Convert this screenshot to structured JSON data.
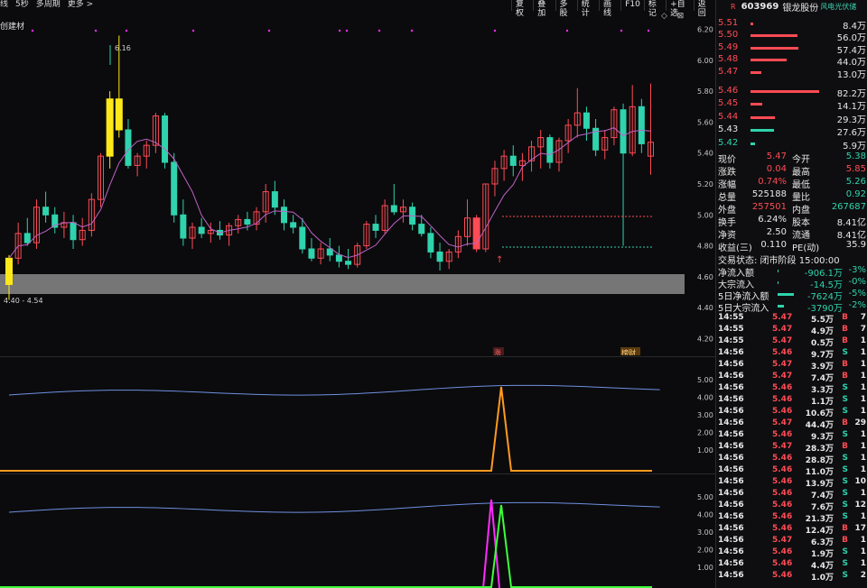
{
  "toolbar_left": [
    "线",
    "5秒",
    "多周期",
    "更多 >"
  ],
  "toolbar_right": [
    "复权",
    "叠加",
    "多股",
    "统计",
    "画线",
    "F10",
    "标记",
    "+自选",
    "返回"
  ],
  "chart_title": "创建材",
  "window_icons": "◇ ⊠",
  "price_high_label": "6.16",
  "price_axis": [
    "6.20",
    "6.00",
    "5.80",
    "5.60",
    "5.40",
    "5.20",
    "5.00",
    "4.80",
    "4.60",
    "4.40",
    "4.20"
  ],
  "band_label": "4.40 - 4.54",
  "sub_axis_1": [
    "5.00",
    "4.00",
    "3.00",
    "2.00",
    "1.00"
  ],
  "sub_axis_2": [
    "5.00",
    "4.00",
    "3.00",
    "2.00",
    "1.00"
  ],
  "marker_zhang": "涨",
  "marker_bangcai": "榜财",
  "colors": {
    "up": "#ff4b55",
    "down": "#2fd3ad",
    "yellow": "#ffe81a",
    "ma": "#c061c8",
    "line": "#6f8fe0",
    "orange": "#ff9a1f",
    "magenta": "#ff2bff",
    "lime": "#3cff3c"
  },
  "stock": {
    "badge": "R",
    "code": "603969",
    "name": "银龙股份",
    "concept": "风电光伏储"
  },
  "asks": [
    {
      "price": "5.51",
      "vol": "8.4万",
      "bar": 0.04
    },
    {
      "price": "5.50",
      "vol": "56.0万",
      "bar": 0.6
    },
    {
      "price": "5.49",
      "vol": "57.4万",
      "bar": 0.62
    },
    {
      "price": "5.48",
      "vol": "44.0万",
      "bar": 0.47
    },
    {
      "price": "5.47",
      "vol": "13.0万",
      "bar": 0.14
    }
  ],
  "bids": [
    {
      "price": "5.46",
      "vol": "82.2万",
      "bar": 0.88,
      "cls": "red"
    },
    {
      "price": "5.45",
      "vol": "14.1万",
      "bar": 0.15,
      "cls": "red"
    },
    {
      "price": "5.44",
      "vol": "29.3万",
      "bar": 0.31,
      "cls": "red"
    },
    {
      "price": "5.43",
      "vol": "27.6万",
      "bar": 0.3,
      "cls": "white"
    },
    {
      "price": "5.42",
      "vol": "5.9万",
      "bar": 0.06,
      "cls": "green"
    }
  ],
  "quote": [
    {
      "l1": "现价",
      "v1": "5.47",
      "c1": "red",
      "l2": "今开",
      "v2": "5.38",
      "c2": "green"
    },
    {
      "l1": "涨跌",
      "v1": "0.04",
      "c1": "red",
      "l2": "最高",
      "v2": "5.85",
      "c2": "red"
    },
    {
      "l1": "涨幅",
      "v1": "0.74%",
      "c1": "red",
      "l2": "最低",
      "v2": "5.26",
      "c2": "green"
    },
    {
      "l1": "总量",
      "v1": "525188",
      "c1": "white",
      "l2": "量比",
      "v2": "0.92",
      "c2": "green"
    },
    {
      "l1": "外盘",
      "v1": "257501",
      "c1": "red",
      "l2": "内盘",
      "v2": "267687",
      "c2": "green"
    },
    {
      "l1": "换手",
      "v1": "6.24%",
      "c1": "white",
      "l2": "股本",
      "v2": "8.41亿",
      "c2": "white"
    },
    {
      "l1": "净资",
      "v1": "2.50",
      "c1": "white",
      "l2": "流通",
      "v2": "8.41亿",
      "c2": "white"
    },
    {
      "l1": "收益(三)",
      "v1": "0.110",
      "c1": "white",
      "l2": "PE(动)",
      "v2": "35.9",
      "c2": "white"
    }
  ],
  "trade_status": "交易状态: 闭市阶段 15:00:00",
  "flows": [
    {
      "label": "净流入额",
      "value": "-906.1万",
      "pct": "-3%",
      "bar": 0.02
    },
    {
      "label": "大宗流入",
      "value": "-14.5万",
      "pct": "-0%",
      "bar": 0.01
    },
    {
      "label": "5日净流入额",
      "value": "-7624万",
      "pct": "-5%",
      "bar": 0.9
    },
    {
      "label": "5日大宗流入",
      "value": "-3790万",
      "pct": "-2%",
      "bar": 0.35
    }
  ],
  "ticks": [
    {
      "t": "14:55",
      "p": "5.47",
      "v": "5.5万",
      "s": "B",
      "n": "7"
    },
    {
      "t": "14:55",
      "p": "5.47",
      "v": "4.9万",
      "s": "B",
      "n": "7"
    },
    {
      "t": "14:55",
      "p": "5.47",
      "v": "0.5万",
      "s": "B",
      "n": "1"
    },
    {
      "t": "14:56",
      "p": "5.46",
      "v": "9.7万",
      "s": "S",
      "n": "1"
    },
    {
      "t": "14:56",
      "p": "5.47",
      "v": "3.9万",
      "s": "B",
      "n": "1"
    },
    {
      "t": "14:56",
      "p": "5.47",
      "v": "7.4万",
      "s": "B",
      "n": "1"
    },
    {
      "t": "14:56",
      "p": "5.46",
      "v": "3.3万",
      "s": "S",
      "n": "1"
    },
    {
      "t": "14:56",
      "p": "5.46",
      "v": "1.1万",
      "s": "S",
      "n": "1"
    },
    {
      "t": "14:56",
      "p": "5.46",
      "v": "10.6万",
      "s": "S",
      "n": "1"
    },
    {
      "t": "14:56",
      "p": "5.47",
      "v": "44.4万",
      "s": "B",
      "n": "29"
    },
    {
      "t": "14:56",
      "p": "5.46",
      "v": "9.3万",
      "s": "S",
      "n": "1"
    },
    {
      "t": "14:56",
      "p": "5.47",
      "v": "28.3万",
      "s": "B",
      "n": "1"
    },
    {
      "t": "14:56",
      "p": "5.46",
      "v": "28.8万",
      "s": "S",
      "n": "1"
    },
    {
      "t": "14:56",
      "p": "5.46",
      "v": "11.0万",
      "s": "S",
      "n": "1"
    },
    {
      "t": "14:56",
      "p": "5.46",
      "v": "13.9万",
      "s": "S",
      "n": "10"
    },
    {
      "t": "14:56",
      "p": "5.46",
      "v": "7.4万",
      "s": "S",
      "n": "1"
    },
    {
      "t": "14:56",
      "p": "5.46",
      "v": "7.6万",
      "s": "S",
      "n": "12"
    },
    {
      "t": "14:56",
      "p": "5.46",
      "v": "21.3万",
      "s": "S",
      "n": "1"
    },
    {
      "t": "14:56",
      "p": "5.46",
      "v": "12.4万",
      "s": "B",
      "n": "17"
    },
    {
      "t": "14:56",
      "p": "5.47",
      "v": "6.3万",
      "s": "B",
      "n": "1"
    },
    {
      "t": "14:56",
      "p": "5.46",
      "v": "1.9万",
      "s": "S",
      "n": "1"
    },
    {
      "t": "14:56",
      "p": "5.46",
      "v": "4.4万",
      "s": "S",
      "n": "1"
    },
    {
      "t": "14:56",
      "p": "5.46",
      "v": "1.0万",
      "s": "S",
      "n": "2"
    }
  ],
  "chart_data": {
    "type": "candlestick",
    "candles": [
      [
        4.55,
        4.74,
        4.45,
        4.72
      ],
      [
        4.72,
        4.95,
        4.68,
        4.88
      ],
      [
        4.88,
        4.98,
        4.8,
        4.82
      ],
      [
        4.82,
        5.1,
        4.78,
        5.05
      ],
      [
        5.05,
        5.15,
        4.95,
        5.0
      ],
      [
        5.0,
        5.05,
        4.88,
        4.92
      ],
      [
        4.92,
        5.02,
        4.85,
        4.95
      ],
      [
        4.95,
        5.0,
        4.78,
        4.84
      ],
      [
        4.84,
        4.98,
        4.8,
        4.9
      ],
      [
        4.9,
        5.14,
        4.86,
        5.1
      ],
      [
        5.1,
        5.4,
        5.05,
        5.38
      ],
      [
        5.38,
        5.8,
        5.3,
        5.75
      ],
      [
        5.75,
        6.16,
        5.5,
        5.55
      ],
      [
        5.55,
        5.62,
        5.3,
        5.32
      ],
      [
        5.32,
        5.4,
        5.25,
        5.38
      ],
      [
        5.38,
        5.48,
        5.3,
        5.45
      ],
      [
        5.45,
        5.66,
        5.4,
        5.64
      ],
      [
        5.64,
        5.66,
        5.3,
        5.34
      ],
      [
        5.34,
        5.4,
        4.95,
        5.0
      ],
      [
        5.0,
        5.1,
        4.8,
        4.85
      ],
      [
        4.85,
        4.95,
        4.78,
        4.92
      ],
      [
        4.92,
        4.98,
        4.85,
        4.88
      ],
      [
        4.88,
        4.95,
        4.82,
        4.9
      ],
      [
        4.9,
        4.96,
        4.84,
        4.87
      ],
      [
        4.87,
        4.95,
        4.8,
        4.93
      ],
      [
        4.93,
        5.0,
        4.88,
        4.97
      ],
      [
        4.97,
        5.02,
        4.9,
        4.94
      ],
      [
        4.94,
        5.05,
        4.9,
        5.02
      ],
      [
        5.02,
        5.2,
        4.95,
        5.15
      ],
      [
        5.15,
        5.22,
        5.0,
        5.05
      ],
      [
        5.05,
        5.1,
        4.9,
        4.95
      ],
      [
        4.95,
        5.0,
        4.88,
        4.92
      ],
      [
        4.92,
        4.98,
        4.75,
        4.78
      ],
      [
        4.78,
        4.85,
        4.7,
        4.72
      ],
      [
        4.72,
        4.82,
        4.68,
        4.78
      ],
      [
        4.78,
        4.85,
        4.7,
        4.74
      ],
      [
        4.74,
        4.8,
        4.66,
        4.7
      ],
      [
        4.7,
        4.78,
        4.65,
        4.68
      ],
      [
        4.68,
        4.82,
        4.66,
        4.8
      ],
      [
        4.8,
        4.96,
        4.78,
        4.94
      ],
      [
        4.94,
        5.0,
        4.85,
        4.9
      ],
      [
        4.9,
        5.1,
        4.88,
        5.06
      ],
      [
        5.06,
        5.2,
        5.0,
        5.02
      ],
      [
        5.02,
        5.1,
        4.95,
        5.05
      ],
      [
        5.05,
        5.08,
        4.9,
        4.94
      ],
      [
        4.94,
        5.0,
        4.86,
        4.88
      ],
      [
        4.88,
        4.92,
        4.72,
        4.76
      ],
      [
        4.76,
        4.82,
        4.64,
        4.7
      ],
      [
        4.7,
        4.78,
        4.65,
        4.76
      ],
      [
        4.76,
        4.9,
        4.72,
        4.86
      ],
      [
        4.86,
        5.1,
        4.8,
        4.98
      ],
      [
        4.98,
        5.0,
        4.76,
        4.78
      ],
      [
        4.78,
        5.2,
        4.76,
        5.2
      ],
      [
        5.2,
        5.35,
        5.12,
        5.3
      ],
      [
        5.3,
        5.42,
        5.22,
        5.38
      ],
      [
        5.38,
        5.45,
        5.25,
        5.32
      ],
      [
        5.32,
        5.4,
        5.22,
        5.35
      ],
      [
        5.35,
        5.48,
        5.28,
        5.44
      ],
      [
        5.44,
        5.55,
        5.3,
        5.5
      ],
      [
        5.5,
        5.52,
        5.3,
        5.34
      ],
      [
        5.34,
        5.5,
        5.28,
        5.48
      ],
      [
        5.48,
        5.62,
        5.4,
        5.58
      ],
      [
        5.58,
        5.82,
        5.5,
        5.66
      ],
      [
        5.66,
        5.7,
        5.48,
        5.56
      ],
      [
        5.56,
        5.62,
        5.38,
        5.42
      ],
      [
        5.42,
        5.55,
        5.36,
        5.5
      ],
      [
        5.5,
        5.7,
        5.45,
        5.68
      ],
      [
        5.68,
        5.72,
        4.8,
        5.4
      ],
      [
        5.4,
        5.84,
        5.38,
        5.7
      ],
      [
        5.7,
        5.75,
        5.4,
        5.46
      ],
      [
        5.38,
        5.85,
        5.26,
        5.47
      ]
    ],
    "highlight_bars": [
      "yellow@0",
      "yellow@11",
      "yellow@12",
      "red@51"
    ],
    "ylim": [
      4.15,
      6.25
    ]
  }
}
